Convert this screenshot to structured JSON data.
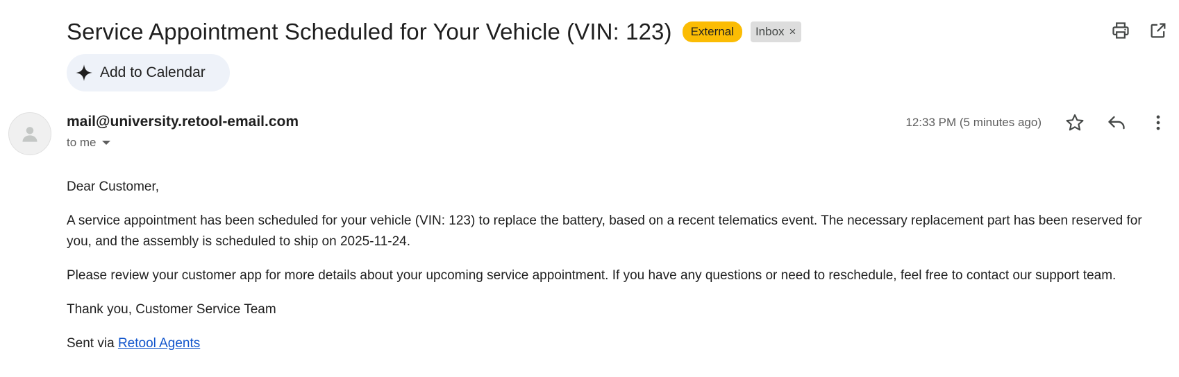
{
  "email": {
    "subject": "Service Appointment Scheduled for Your Vehicle (VIN: 123)",
    "labels": {
      "external": "External",
      "inbox": "Inbox",
      "inbox_remove": "×"
    },
    "calendar_button": "Add to Calendar",
    "sender": "mail@university.retool-email.com",
    "recipient": "to me",
    "timestamp": "12:33 PM (5 minutes ago)",
    "body": {
      "greeting": "Dear Customer,",
      "paragraph1": "A service appointment has been scheduled for your vehicle (VIN: 123) to replace the battery, based on a recent telematics event. The necessary replacement part has been reserved for you, and the assembly is scheduled to ship on 2025-11-24.",
      "paragraph2": "Please review your customer app for more details about your upcoming service appointment. If you have any questions or need to reschedule, feel free to contact our support team.",
      "signoff": "Thank you, Customer Service Team",
      "sent_via_prefix": "Sent via ",
      "sent_via_link": "Retool Agents"
    }
  },
  "icons": {
    "header": [
      "print-icon",
      "open-in-new-window-icon"
    ],
    "message": [
      "star-icon",
      "reply-icon",
      "more-vertical-icon"
    ],
    "calendar": "sparkle-icon",
    "avatar": "person-icon"
  },
  "colors": {
    "external_badge": "#fbbc04",
    "inbox_badge": "#dddddd",
    "calendar_button": "#eef2f9",
    "link": "#1155cc"
  }
}
